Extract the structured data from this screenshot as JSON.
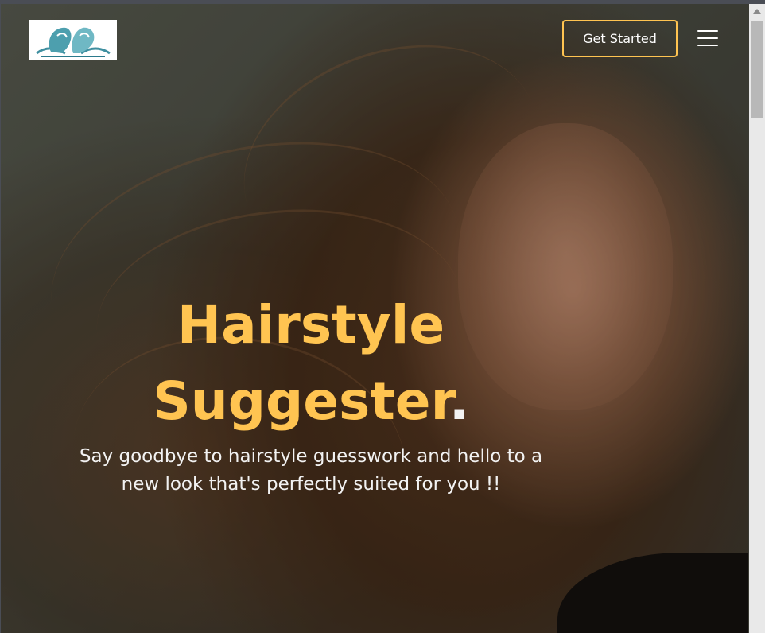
{
  "header": {
    "logo_name": "hair-silhouette-logo",
    "cta_label": "Get Started",
    "menu_icon": "hamburger-menu-icon"
  },
  "hero": {
    "title_line1": "Hairstyle",
    "title_line2": "Suggester",
    "title_dot": ".",
    "subtitle_line1": "Say goodbye to hairstyle guesswork and hello to a",
    "subtitle_line2": "new look that's perfectly suited for you !!"
  },
  "colors": {
    "accent": "#ffc451",
    "text_light": "#f2f2f2"
  },
  "scrollbar": {
    "position_fraction": 0.0
  }
}
